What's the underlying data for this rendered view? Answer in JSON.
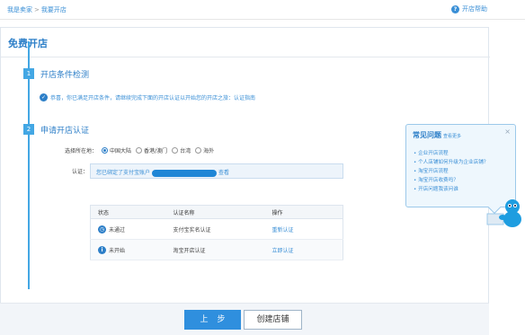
{
  "breadcrumb": {
    "home": "我是卖家",
    "sep": ">",
    "current": "我要开店"
  },
  "help": {
    "label": "开店帮助"
  },
  "page": {
    "title": "免费开店"
  },
  "steps": [
    {
      "num": "1",
      "title": "开店条件检测"
    },
    {
      "num": "2",
      "title": "申请开店认证"
    }
  ],
  "condition": {
    "text": "恭喜，你已满足开店条件，请继续完成下面的开店认证以开始您的开店之旅：认证指南"
  },
  "location": {
    "label": "选择所在地：",
    "options": [
      "中国大陆",
      "香港/澳门",
      "台湾",
      "海外"
    ],
    "selected": "中国大陆"
  },
  "auth": {
    "label": "认证：",
    "prefix": "您已绑定了支付宝账户",
    "suffix": "查看"
  },
  "table": {
    "headers": [
      "状态",
      "认证名称",
      "操作"
    ],
    "rows": [
      {
        "status": "未通过",
        "status_icon": "clock-icon",
        "name": "支付宝实名认证",
        "action": "重新认证"
      },
      {
        "status": "未开始",
        "status_icon": "info-icon",
        "name": "淘宝开店认证",
        "action": "立即认证"
      }
    ]
  },
  "buttons": {
    "prev": "上步",
    "create": "创建店铺"
  },
  "faq": {
    "title": "常见问题",
    "subtitle": "查看更多",
    "close": "×",
    "items": [
      "企业开店流程",
      "个人店铺如何升级为企业店铺？",
      "淘宝开店流程",
      "淘宝开店收费吗？",
      "开店问题我该问谁"
    ]
  },
  "colors": {
    "accent": "#2d7fc8",
    "button": "#2f8fde",
    "timeline": "#43a7e4"
  }
}
